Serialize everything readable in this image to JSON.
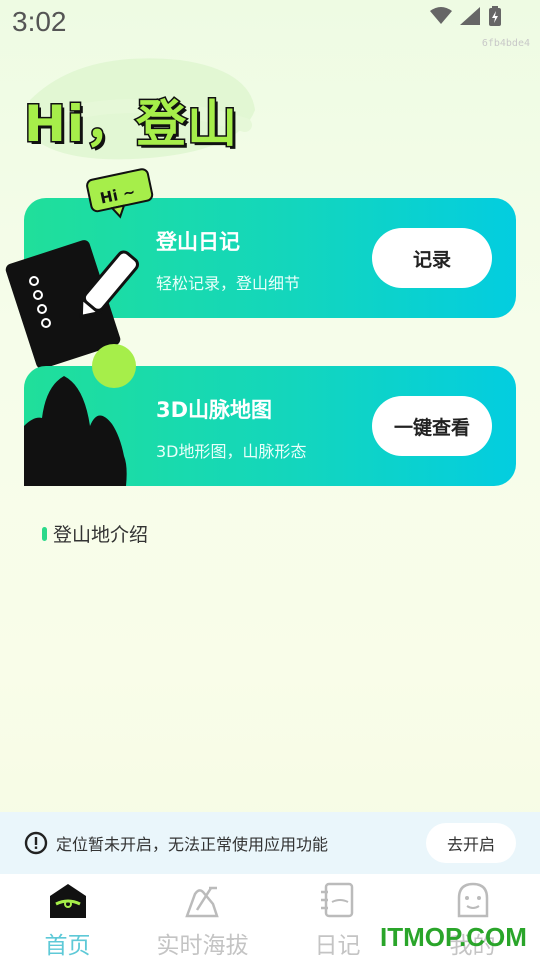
{
  "status_bar": {
    "time": "3:02",
    "code": "6fb4bde4"
  },
  "greeting": "Hi，登山",
  "cards": [
    {
      "title": "登山日记",
      "subtitle": "轻松记录，登山细节",
      "button": "记录",
      "bubble": "Hi ~"
    },
    {
      "title": "3D山脉地图",
      "subtitle": "3D地形图，山脉形态",
      "button": "一键查看"
    }
  ],
  "section": {
    "title": "登山地介绍"
  },
  "notice": {
    "text": "定位暂未开启，无法正常使用应用功能",
    "button": "去开启"
  },
  "tabs": [
    {
      "label": "首页",
      "icon": "home-icon",
      "active": true
    },
    {
      "label": "实时海拔",
      "icon": "altitude-icon",
      "active": false
    },
    {
      "label": "日记",
      "icon": "diary-icon",
      "active": false
    },
    {
      "label": "我的",
      "icon": "profile-icon",
      "active": false
    }
  ],
  "watermark": "ITMOP.COM",
  "colors": {
    "accent_green": "#a6ee4a",
    "card_start": "#20df9a",
    "card_end": "#03cde0",
    "tab_active": "#5ec9d7"
  }
}
